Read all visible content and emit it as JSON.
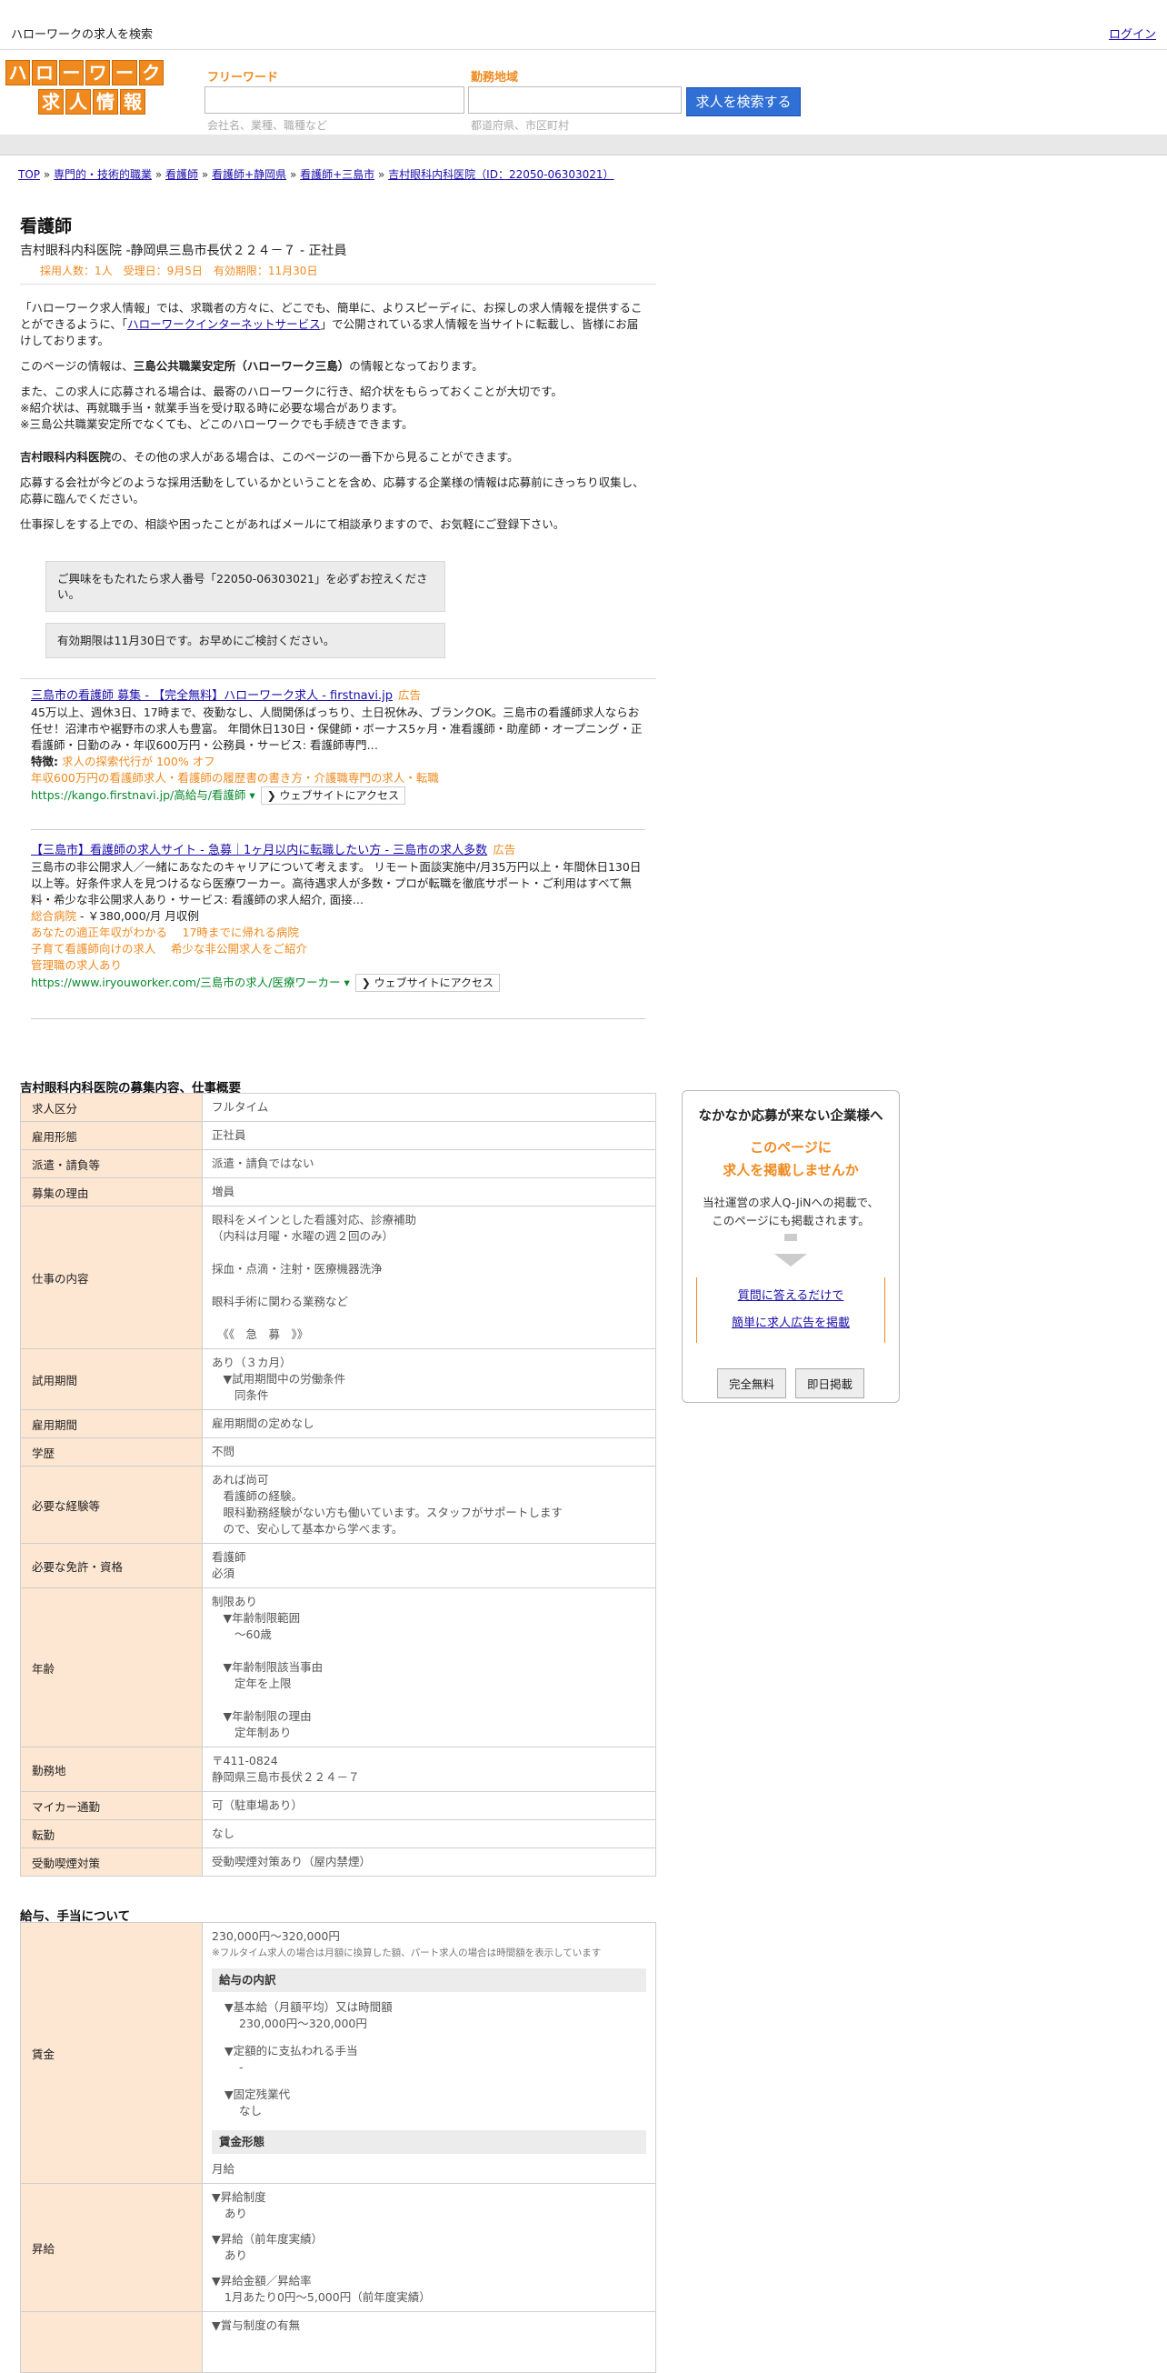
{
  "topbar": {
    "site_title": "ハローワークの求人を検索",
    "login": "ログイン"
  },
  "logo": {
    "row1": [
      "ハ",
      "ロ",
      "ー",
      "ワ",
      "ー",
      "ク"
    ],
    "row2": [
      "求",
      "人",
      "情",
      "報"
    ]
  },
  "search": {
    "keyword_label": "フリーワード",
    "keyword_hint": "会社名、業種、職種など",
    "area_label": "勤務地域",
    "area_hint": "都道府県、市区町村",
    "button": "求人を検索する"
  },
  "breadcrumb": [
    "TOP",
    "専門的・技術的職業",
    "看護師",
    "看護師+静岡県",
    "看護師+三島市",
    "吉村眼科内科医院（ID：22050-06303021）"
  ],
  "breadcrumb_sep": "»",
  "job": {
    "title": "看護師",
    "subtitle": "吉村眼科内科医院 -静岡県三島市長伏２２４－７ - 正社員",
    "meta": "採用人数：1人　受理日：9月5日　有効期限：11月30日"
  },
  "intro": {
    "p1a": "「ハローワーク求人情報」では、求職者の方々に、どこでも、簡単に、よりスピーディに、お探しの求人情報を提供することができるように、「",
    "p1link": "ハローワークインターネットサービス",
    "p1b": "」で公開されている求人情報を当サイトに転載し、皆様にお届けしております。",
    "p2a": "このページの情報は、",
    "p2b": "三島公共職業安定所（ハローワーク三島）",
    "p2c": "の情報となっております。",
    "p3l1": "また、この求人に応募される場合は、最寄のハローワークに行き、紹介状をもらっておくことが大切です。",
    "p3l2": "※紹介状は、再就職手当・就業手当を受け取る時に必要な場合があります。",
    "p3l3": "※三島公共職業安定所でなくても、どこのハローワークでも手続きできます。",
    "p4a": "吉村眼科内科医院",
    "p4b": "の、その他の求人がある場合は、このページの一番下から見ることができます。",
    "p5": "応募する会社が今どのような採用活動をしているかということを含め、応募する企業様の情報は応募前にきっちり収集し、応募に臨んでください。",
    "p6": "仕事探しをする上での、相談や困ったことがあればメールにて相談承りますので、お気軽にご登録下さい。"
  },
  "notes": {
    "n1": "ご興味をもたれたら求人番号「22050-06303021」を必ずお控えください。",
    "n2": "有効期限は11月30日です。お早めにご検討ください。"
  },
  "ads": [
    {
      "title": "三島市の看護師 募集 - 【完全無料】ハローワーク求人 - firstnavi.jp",
      "tag": "広告",
      "body": "45万以上、週休3日、17時まで、夜勤なし、人間関係ばっちり、土日祝休み、ブランクOK。三島市の看護師求人ならお任せ！沼津市や裾野市の求人も豊富。 年間休日130日・保健師・ボーナス5ヶ月・准看護師・助産師・オープニング・正看護師・日勤のみ・年収600万円・公務員・サービス: 看護師専門…",
      "feature_label": "特徴:",
      "feature": "求人の探索代行が 100% オフ",
      "sitelink": "年収600万円の看護師求人・看護師の履歴書の書き方・介護職専門の求人・転職",
      "url": "https://kango.firstnavi.jp/高給与/看護師",
      "visit": "❯ ウェブサイトにアクセス"
    },
    {
      "title": "【三島市】看護師の求人サイト - 急募｜1ヶ月以内に転職したい方 - 三島市の求人多数",
      "tag": "広告",
      "body": "三島市の非公開求人／一緒にあなたのキャリアについて考えます。 リモート面談実施中/月35万円以上・年間休日130日以上等。好条件求人を見つけるなら医療ワーカー。高待遇求人が多数・プロが転職を徹底サポート・ご利用はすべて無料・希少な非公開求人あり・サービス: 看護師の求人紹介, 面接…",
      "price_label": "総合病院",
      "price": " - ￥380,000/月 月収例",
      "links": [
        [
          "あなたの適正年収がわかる",
          "17時までに帰れる病院"
        ],
        [
          "子育て看護師向けの求人",
          "希少な非公開求人をご紹介"
        ],
        [
          "管理職の求人あり"
        ]
      ],
      "url": "https://www.iryouworker.com/三島市の求人/医療ワーカー",
      "visit": "❯ ウェブサイトにアクセス"
    }
  ],
  "section1": {
    "title": "吉村眼科内科医院の募集内容、仕事概要",
    "rows": [
      {
        "k": "求人区分",
        "v": [
          "フルタイム"
        ]
      },
      {
        "k": "雇用形態",
        "v": [
          "正社員"
        ]
      },
      {
        "k": "派遣・請負等",
        "v": [
          "派遣・請負ではない"
        ]
      },
      {
        "k": "募集の理由",
        "v": [
          "増員"
        ]
      },
      {
        "k": "仕事の内容",
        "v": [
          "眼科をメインとした看護対応、診療補助",
          "（内科は月曜・水曜の週２回のみ）",
          "",
          "採血・点滴・注射・医療機器洗浄",
          "",
          "眼科手術に関わる業務など",
          "",
          "　《《　急　募　》》"
        ]
      },
      {
        "k": "試用期間",
        "v": [
          "あり（３カ月）",
          "　▼試用期間中の労働条件",
          "　　同条件"
        ]
      },
      {
        "k": "雇用期間",
        "v": [
          "雇用期間の定めなし"
        ]
      },
      {
        "k": "学歴",
        "v": [
          "不問"
        ]
      },
      {
        "k": "必要な経験等",
        "v": [
          "あれば尚可",
          "　看護師の経験。",
          "　眼科勤務経験がない方も働いています。スタッフがサポートします",
          "　ので、安心して基本から学べます。"
        ]
      },
      {
        "k": "必要な免許・資格",
        "v": [
          "看護師",
          "必須"
        ]
      },
      {
        "k": "年齢",
        "v": [
          "制限あり",
          "　▼年齢制限範囲",
          "　　〜60歳",
          "",
          "　▼年齢制限該当事由",
          "　　定年を上限",
          "",
          "　▼年齢制限の理由",
          "　　定年制あり"
        ]
      },
      {
        "k": "勤務地",
        "v": [
          "〒411-0824",
          "静岡県三島市長伏２２４－７"
        ]
      },
      {
        "k": "マイカー通勤",
        "v": [
          "可（駐車場あり）"
        ]
      },
      {
        "k": "転勤",
        "v": [
          "なし"
        ]
      },
      {
        "k": "受動喫煙対策",
        "v": [
          "受動喫煙対策あり（屋内禁煙）"
        ]
      }
    ]
  },
  "section2": {
    "title": "給与、手当について",
    "wage_k": "賃金",
    "wage_range": "230,000円〜320,000円",
    "wage_note": "※フルタイム求人の場合は月額に換算した額、パート求人の場合は時間額を表示しています",
    "breakdown_h": "給与の内訳",
    "b1": "▼基本給（月額平均）又は時間額",
    "b1v": "230,000円〜320,000円",
    "b2": "▼定額的に支払われる手当",
    "b2v": "-",
    "b3": "▼固定残業代",
    "b3v": "なし",
    "form_h": "賃金形態",
    "form_v": "月給",
    "raise_k": "昇給",
    "r1": "▼昇給制度",
    "r1v": "あり",
    "r2": "▼昇給（前年度実績）",
    "r2v": "あり",
    "r3": "▼昇給金額／昇給率",
    "r3v": "1月あたり0円〜5,000円（前年度実績）",
    "bonus_partial": "▼賞与制度の有無"
  },
  "sidebox": {
    "heading": "なかなか応募が来ない企業様へ",
    "orange1": "このページに",
    "orange2": "求人を掲載しませんか",
    "desc1": "当社運営の求人Q-JiNへの掲載で、",
    "desc2": "このページにも掲載されます。",
    "link1": "質問に答えるだけで",
    "link2": "簡単に求人広告を掲載",
    "btn1": "完全無料",
    "btn2": "即日掲載"
  }
}
